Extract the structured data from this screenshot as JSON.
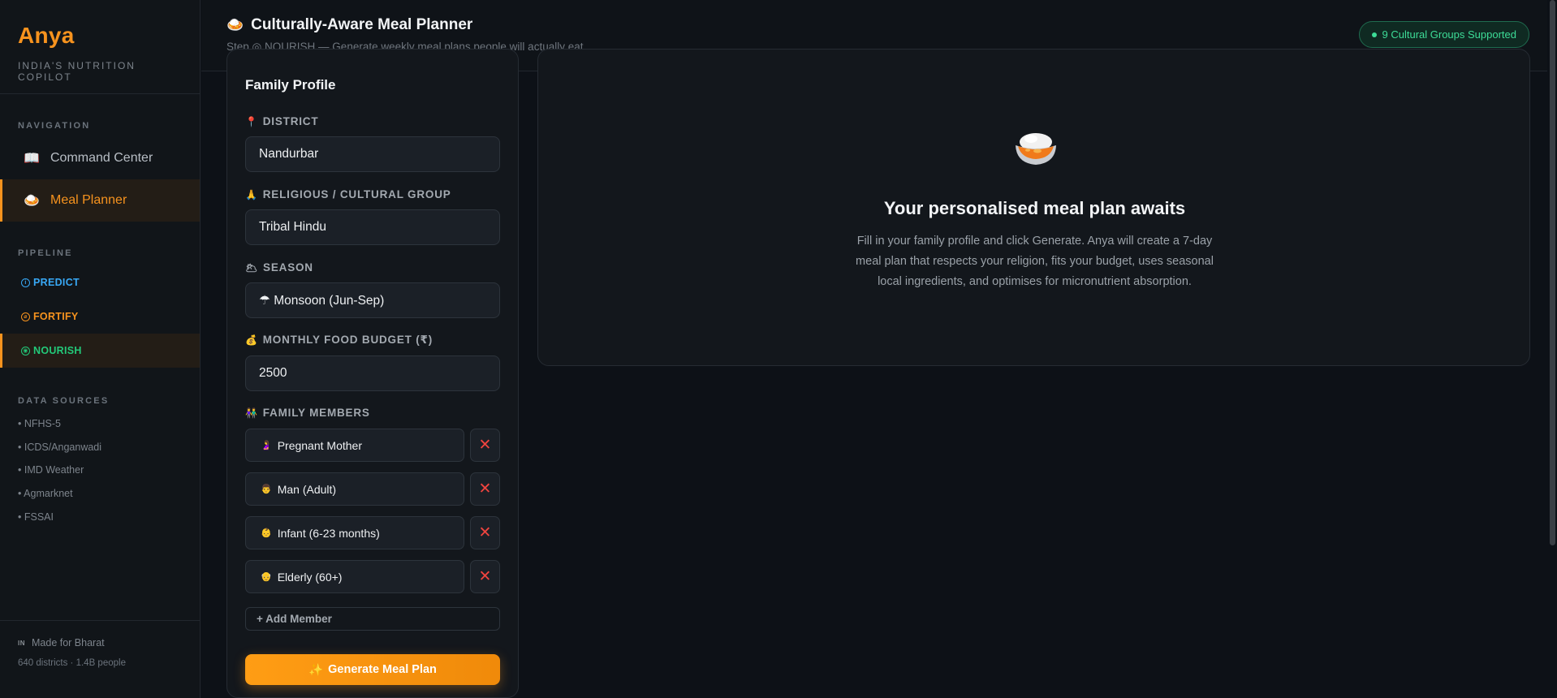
{
  "brand": {
    "name": "Anya",
    "tagline": "INDIA'S NUTRITION COPILOT"
  },
  "nav": {
    "label": "NAVIGATION",
    "items": [
      {
        "icon": "book-icon",
        "glyph": "📖",
        "label": "Command Center",
        "active": false
      },
      {
        "icon": "bowl-icon",
        "glyph": "🍛",
        "label": "Meal Planner",
        "active": true
      }
    ]
  },
  "pipeline": {
    "label": "PIPELINE",
    "items": [
      {
        "glyph": "i",
        "label": "PREDICT",
        "color": "#38a8f5",
        "active": false
      },
      {
        "glyph": "⌀",
        "label": "FORTIFY",
        "color": "#f7931e",
        "active": false
      },
      {
        "glyph": "◉",
        "label": "NOURISH",
        "color": "#22c979",
        "active": true
      }
    ]
  },
  "data_sources": {
    "label": "DATA SOURCES",
    "items": [
      "• NFHS-5",
      "• ICDS/Anganwadi",
      "• IMD Weather",
      "• Agmarknet",
      "• FSSAI"
    ]
  },
  "footer": {
    "flag": "IN",
    "line1": "Made for Bharat",
    "line2": "640 districts · 1.4B people"
  },
  "header": {
    "icon": "🍛",
    "title": "Culturally-Aware Meal Planner",
    "subtitle": "Step ◎ NOURISH — Generate weekly meal plans people will actually eat",
    "badge": "9 Cultural Groups Supported"
  },
  "form": {
    "title": "Family Profile",
    "district": {
      "icon": "📍",
      "label": "DISTRICT",
      "value": "Nandurbar"
    },
    "group": {
      "icon": "🙏",
      "label": "RELIGIOUS / CULTURAL GROUP",
      "value": "Tribal Hindu"
    },
    "season": {
      "icon": "🌥",
      "label": "SEASON",
      "value": "☂ Monsoon (Jun-Sep)"
    },
    "budget": {
      "icon": "💰",
      "label": "MONTHLY FOOD BUDGET (₹)",
      "value": "2500"
    },
    "members": {
      "icon": "👫",
      "label": "FAMILY MEMBERS",
      "items": [
        {
          "glyph": "🤰",
          "label": "Pregnant Mother"
        },
        {
          "glyph": "👨",
          "label": "Man (Adult)"
        },
        {
          "glyph": "👶",
          "label": "Infant (6-23 months)"
        },
        {
          "glyph": "👴",
          "label": "Elderly (60+)"
        }
      ],
      "remove_glyph": "✕"
    },
    "add_member": "+ Add Member",
    "generate": {
      "icon": "✨",
      "label": "Generate Meal Plan"
    }
  },
  "result": {
    "title": "Your personalised meal plan awaits",
    "description": "Fill in your family profile and click Generate. Anya will create a 7-day meal plan that respects your religion, fits your budget, uses seasonal local ingredients, and optimises for micronutrient absorption."
  },
  "colors": {
    "accent": "#f7931e",
    "success": "#3ddc97",
    "danger": "#f0443f",
    "info": "#38a8f5"
  }
}
